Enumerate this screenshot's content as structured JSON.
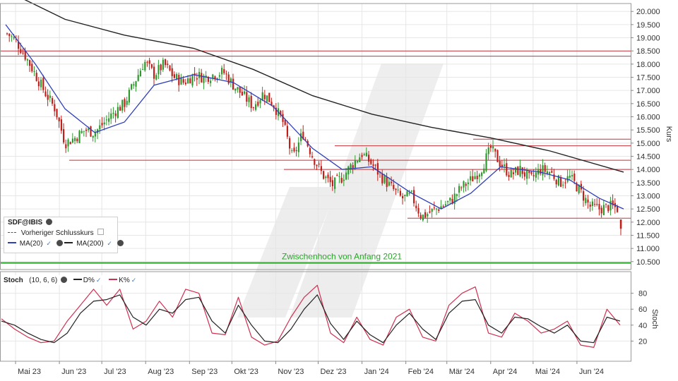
{
  "chart_data": [
    {
      "type": "line",
      "panel": "price",
      "instrument": "SDF@IBIS",
      "y_axis_label": "Kurs",
      "ylim": [
        10.2,
        20.3
      ],
      "y_ticks": [
        "20.000",
        "19.500",
        "19.000",
        "18.500",
        "18.000",
        "17.500",
        "17.000",
        "16.500",
        "16.000",
        "15.500",
        "15.000",
        "14.500",
        "14.000",
        "13.500",
        "13.000",
        "12.500",
        "12.000",
        "11.500",
        "11.000",
        "10.500"
      ],
      "x_tick_labels": [
        "Mai 23",
        "Jun '23",
        "Jul '23",
        "Aug '23",
        "Sep '23",
        "Okt '23",
        "Nov '23",
        "Dez '23",
        "Jan '24",
        "Feb '24",
        "Mär '24",
        "Apr '24",
        "Mai '24",
        "Jun '24"
      ],
      "grid": true,
      "legend": {
        "title": "SDF@IBIS",
        "items": [
          "Vorheriger Schlusskurs",
          "MA(20)",
          "MA(200)"
        ]
      },
      "annotation": "Zwischenhoch von Anfang 2021",
      "horizontal_levels": {
        "resistance_red": [
          18.5,
          18.3,
          14.9,
          14.35,
          14.0,
          12.15,
          15.15
        ],
        "support_green": 10.45
      },
      "price_series": [
        {
          "t": "2023-04-24",
          "v": 19.2
        },
        {
          "t": "2023-05-01",
          "v": 18.9
        },
        {
          "t": "2023-05-08",
          "v": 18.3
        },
        {
          "t": "2023-05-15",
          "v": 17.6
        },
        {
          "t": "2023-05-22",
          "v": 16.9
        },
        {
          "t": "2023-05-29",
          "v": 16.3
        },
        {
          "t": "2023-06-05",
          "v": 15.0
        },
        {
          "t": "2023-06-12",
          "v": 15.2
        },
        {
          "t": "2023-06-19",
          "v": 15.5
        },
        {
          "t": "2023-06-26",
          "v": 15.4
        },
        {
          "t": "2023-07-03",
          "v": 15.8
        },
        {
          "t": "2023-07-10",
          "v": 16.2
        },
        {
          "t": "2023-07-17",
          "v": 16.5
        },
        {
          "t": "2023-07-24",
          "v": 17.3
        },
        {
          "t": "2023-07-31",
          "v": 18.1
        },
        {
          "t": "2023-08-07",
          "v": 17.6
        },
        {
          "t": "2023-08-14",
          "v": 18.0
        },
        {
          "t": "2023-08-21",
          "v": 17.5
        },
        {
          "t": "2023-08-28",
          "v": 17.3
        },
        {
          "t": "2023-09-04",
          "v": 17.6
        },
        {
          "t": "2023-09-11",
          "v": 17.5
        },
        {
          "t": "2023-09-18",
          "v": 17.6
        },
        {
          "t": "2023-09-25",
          "v": 17.7
        },
        {
          "t": "2023-10-02",
          "v": 17.2
        },
        {
          "t": "2023-10-09",
          "v": 16.8
        },
        {
          "t": "2023-10-16",
          "v": 16.4
        },
        {
          "t": "2023-10-23",
          "v": 16.9
        },
        {
          "t": "2023-10-30",
          "v": 16.5
        },
        {
          "t": "2023-11-06",
          "v": 15.8
        },
        {
          "t": "2023-11-13",
          "v": 14.4
        },
        {
          "t": "2023-11-20",
          "v": 15.4
        },
        {
          "t": "2023-11-27",
          "v": 14.5
        },
        {
          "t": "2023-12-04",
          "v": 13.8
        },
        {
          "t": "2023-12-11",
          "v": 13.4
        },
        {
          "t": "2023-12-18",
          "v": 13.7
        },
        {
          "t": "2023-12-25",
          "v": 14.2
        },
        {
          "t": "2024-01-01",
          "v": 14.6
        },
        {
          "t": "2024-01-08",
          "v": 14.2
        },
        {
          "t": "2024-01-15",
          "v": 13.7
        },
        {
          "t": "2024-01-22",
          "v": 13.3
        },
        {
          "t": "2024-01-29",
          "v": 12.9
        },
        {
          "t": "2024-02-05",
          "v": 13.0
        },
        {
          "t": "2024-02-12",
          "v": 12.2
        },
        {
          "t": "2024-02-19",
          "v": 12.4
        },
        {
          "t": "2024-02-26",
          "v": 12.6
        },
        {
          "t": "2024-03-04",
          "v": 12.8
        },
        {
          "t": "2024-03-11",
          "v": 13.3
        },
        {
          "t": "2024-03-18",
          "v": 13.6
        },
        {
          "t": "2024-03-25",
          "v": 14.0
        },
        {
          "t": "2024-04-01",
          "v": 14.8
        },
        {
          "t": "2024-04-08",
          "v": 14.2
        },
        {
          "t": "2024-04-15",
          "v": 13.8
        },
        {
          "t": "2024-04-22",
          "v": 14.0
        },
        {
          "t": "2024-04-29",
          "v": 13.6
        },
        {
          "t": "2024-05-06",
          "v": 14.0
        },
        {
          "t": "2024-05-13",
          "v": 13.9
        },
        {
          "t": "2024-05-20",
          "v": 13.5
        },
        {
          "t": "2024-05-27",
          "v": 13.7
        },
        {
          "t": "2024-06-03",
          "v": 13.2
        },
        {
          "t": "2024-06-10",
          "v": 12.6
        },
        {
          "t": "2024-06-17",
          "v": 12.5
        },
        {
          "t": "2024-06-24",
          "v": 12.6
        },
        {
          "t": "2024-07-01",
          "v": 12.5
        },
        {
          "t": "2024-07-04",
          "v": 11.6
        }
      ],
      "ma20": [
        {
          "t": "2023-04-24",
          "v": 19.5
        },
        {
          "t": "2023-05-15",
          "v": 18.0
        },
        {
          "t": "2023-06-05",
          "v": 16.3
        },
        {
          "t": "2023-06-26",
          "v": 15.4
        },
        {
          "t": "2023-07-17",
          "v": 15.8
        },
        {
          "t": "2023-08-07",
          "v": 17.2
        },
        {
          "t": "2023-09-04",
          "v": 17.6
        },
        {
          "t": "2023-10-02",
          "v": 17.3
        },
        {
          "t": "2023-10-30",
          "v": 16.4
        },
        {
          "t": "2023-11-27",
          "v": 14.8
        },
        {
          "t": "2023-12-18",
          "v": 14.0
        },
        {
          "t": "2024-01-08",
          "v": 14.1
        },
        {
          "t": "2024-02-05",
          "v": 13.1
        },
        {
          "t": "2024-02-26",
          "v": 12.5
        },
        {
          "t": "2024-03-18",
          "v": 13.1
        },
        {
          "t": "2024-04-08",
          "v": 14.1
        },
        {
          "t": "2024-05-06",
          "v": 13.9
        },
        {
          "t": "2024-05-27",
          "v": 13.6
        },
        {
          "t": "2024-06-17",
          "v": 12.9
        },
        {
          "t": "2024-07-04",
          "v": 12.5
        }
      ],
      "ma200": [
        {
          "t": "2023-04-24",
          "v": 20.8
        },
        {
          "t": "2023-06-05",
          "v": 19.7
        },
        {
          "t": "2023-07-17",
          "v": 19.1
        },
        {
          "t": "2023-09-04",
          "v": 18.6
        },
        {
          "t": "2023-10-16",
          "v": 17.8
        },
        {
          "t": "2023-11-27",
          "v": 16.8
        },
        {
          "t": "2024-01-08",
          "v": 16.1
        },
        {
          "t": "2024-02-19",
          "v": 15.6
        },
        {
          "t": "2024-04-01",
          "v": 15.2
        },
        {
          "t": "2024-05-13",
          "v": 14.7
        },
        {
          "t": "2024-07-04",
          "v": 13.9
        }
      ]
    },
    {
      "type": "line",
      "panel": "stochastic",
      "indicator": "Stoch",
      "params": "(10, 6, 6)",
      "y_axis_label": "Stoch",
      "ylim": [
        0,
        100
      ],
      "y_ticks": [
        "80",
        "60",
        "40",
        "20"
      ],
      "series": [
        {
          "name": "D%",
          "color": "#222222",
          "values": [
            45,
            40,
            30,
            22,
            18,
            30,
            55,
            70,
            72,
            78,
            50,
            40,
            60,
            55,
            72,
            75,
            45,
            30,
            65,
            40,
            20,
            18,
            35,
            60,
            78,
            42,
            22,
            45,
            28,
            18,
            40,
            55,
            35,
            22,
            55,
            70,
            72,
            40,
            30,
            50,
            48,
            38,
            30,
            40,
            20,
            18,
            50,
            45
          ]
        },
        {
          "name": "K%",
          "color": "#d03050",
          "values": [
            48,
            35,
            25,
            18,
            20,
            45,
            65,
            85,
            65,
            85,
            35,
            45,
            70,
            50,
            85,
            80,
            30,
            28,
            75,
            25,
            15,
            20,
            50,
            75,
            90,
            30,
            18,
            50,
            22,
            15,
            50,
            60,
            25,
            20,
            65,
            80,
            88,
            30,
            25,
            55,
            45,
            30,
            35,
            45,
            15,
            12,
            60,
            40
          ]
        }
      ]
    }
  ],
  "legend_price": {
    "title": "SDF@IBIS",
    "prev_close": "Vorheriger Schlusskurs",
    "ma20": "MA(20)",
    "ma200": "MA(200)"
  },
  "legend_stoch": {
    "title": "Stoch",
    "params": "(10, 6, 6)",
    "d": "D%",
    "k": "K%"
  },
  "annotation_text": "Zwischenhoch von Anfang 2021",
  "colors": {
    "up": "#2e9a2e",
    "down": "#c0201a",
    "ma20": "#2f3fb8",
    "ma200": "#222222",
    "resistance": "#c8323a",
    "support": "#2aa52a",
    "stoch_d": "#222222",
    "stoch_k": "#d03050",
    "grid": "#e6e6e6"
  }
}
